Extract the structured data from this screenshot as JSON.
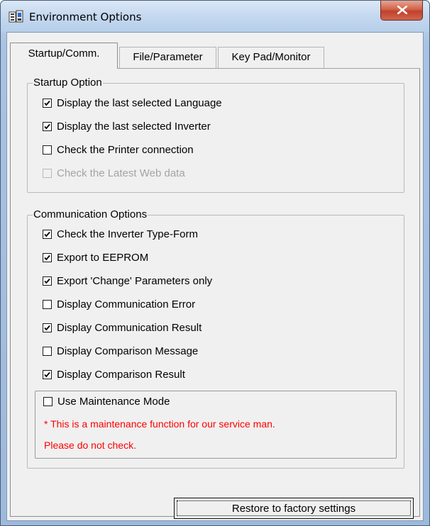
{
  "window": {
    "title": "Environment Options"
  },
  "tabs": [
    {
      "label": "Startup/Comm.",
      "active": true
    },
    {
      "label": "File/Parameter",
      "active": false
    },
    {
      "label": "Key Pad/Monitor",
      "active": false
    }
  ],
  "startup_group": {
    "title": "Startup Option",
    "items": [
      {
        "label": "Display the last selected Language",
        "checked": true,
        "enabled": true
      },
      {
        "label": "Display the last selected Inverter",
        "checked": true,
        "enabled": true
      },
      {
        "label": "Check the Printer connection",
        "checked": false,
        "enabled": true
      },
      {
        "label": "Check the Latest Web data",
        "checked": false,
        "enabled": false
      }
    ]
  },
  "comm_group": {
    "title": "Communication Options",
    "items": [
      {
        "label": "Check the Inverter Type-Form",
        "checked": true,
        "enabled": true
      },
      {
        "label": "Export to EEPROM",
        "checked": true,
        "enabled": true
      },
      {
        "label": "Export 'Change' Parameters only",
        "checked": true,
        "enabled": true
      },
      {
        "label": "Display Communication Error",
        "checked": false,
        "enabled": true
      },
      {
        "label": "Display Communication Result",
        "checked": true,
        "enabled": true
      },
      {
        "label": "Display Comparison Message",
        "checked": false,
        "enabled": true
      },
      {
        "label": "Display Comparison Result",
        "checked": true,
        "enabled": true
      }
    ],
    "maintenance": {
      "label": "Use Maintenance Mode",
      "checked": false,
      "enabled": true,
      "note_line1": "* This is a maintenance function for our service man.",
      "note_line2": "Please do not check."
    }
  },
  "buttons": {
    "restore_label": "Restore to factory settings"
  },
  "colors": {
    "note_text": "#ff0000",
    "close_button": "#c9462f",
    "title_bar": "#c4d8ef"
  },
  "icons": {
    "app": "app-window-icon",
    "close": "close-icon",
    "check": "checkmark-icon"
  }
}
